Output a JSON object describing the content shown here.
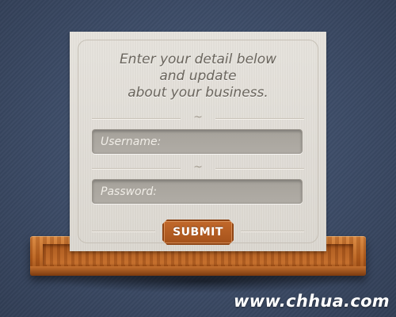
{
  "form": {
    "heading_lines": [
      "Enter your detail below",
      "and update",
      "about your business."
    ],
    "username_placeholder": "Username:",
    "username_value": "",
    "password_placeholder": "Password:",
    "password_value": "",
    "submit_label": "SUBMIT"
  },
  "watermark": "www.chhua.com",
  "colors": {
    "background": "#3c4b66",
    "card": "#e2dfd9",
    "field": "#aaa69f",
    "submit": "#b75e24",
    "wood": "#c06a28"
  },
  "icons": {
    "divider": "ornament-flourish-icon"
  }
}
